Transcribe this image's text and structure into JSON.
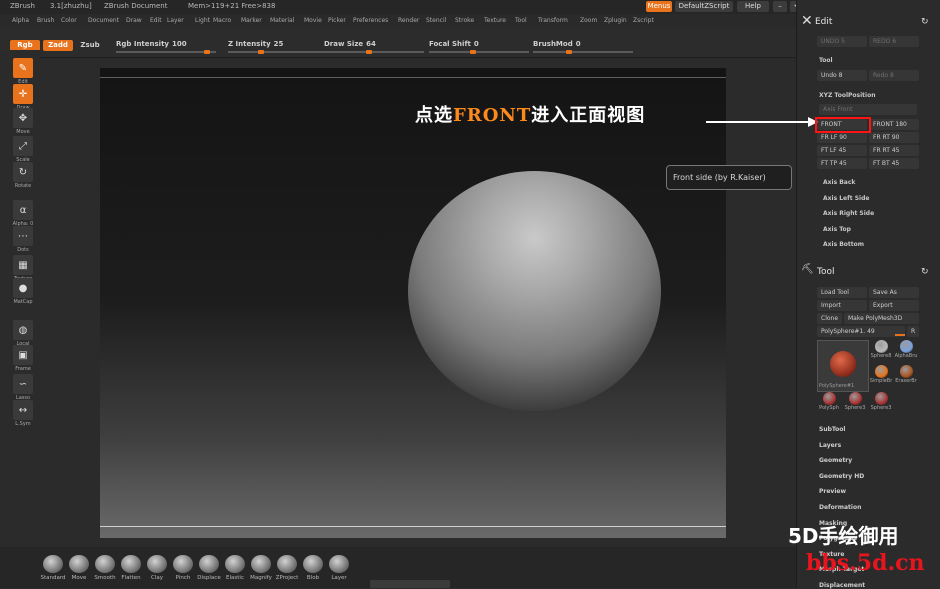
{
  "titlebar": {
    "app": "ZBrush",
    "version": "3.1[zhuzhu]",
    "doc": "ZBrush Document",
    "mem": "Mem>119+21  Free>838",
    "menus_btn": "Menus",
    "script_btn": "DefaultZScript",
    "help_btn": "Help"
  },
  "menubar": [
    "Alpha",
    "Brush",
    "Color",
    "Document",
    "Draw",
    "Edit",
    "Layer",
    "Light",
    "Macro",
    "Marker",
    "Material",
    "Movie",
    "Picker",
    "Preferences",
    "Render",
    "Stencil",
    "Stroke",
    "Texture",
    "Tool",
    "Transform",
    "Zoom",
    "Zplugin",
    "Zscript"
  ],
  "topbar": {
    "rgb": "Rgb",
    "zadd": "Zadd",
    "zsub": "Zsub",
    "sliders": [
      {
        "label": "Rgb Intensity",
        "value": "100"
      },
      {
        "label": "Z Intensity",
        "value": "25"
      },
      {
        "label": "Draw Size",
        "value": "64"
      },
      {
        "label": "Focal Shift",
        "value": "0"
      },
      {
        "label": "BrushMod",
        "value": "0"
      }
    ]
  },
  "lefttools": [
    {
      "label": "Edit",
      "icon": "edit-icon",
      "active": true
    },
    {
      "label": "Draw",
      "icon": "draw-icon",
      "active": true
    },
    {
      "label": "Move",
      "icon": "move-icon"
    },
    {
      "label": "Scale",
      "icon": "scale-icon"
    },
    {
      "label": "Rotate",
      "icon": "rotate-icon"
    },
    {
      "label": "Alpha: 0",
      "icon": "alpha-icon"
    },
    {
      "label": "Dots",
      "icon": "dots-icon"
    },
    {
      "label": "Texture",
      "icon": "texture-icon"
    },
    {
      "label": "MatCap",
      "icon": "matcap-icon"
    },
    {
      "label": "Local",
      "icon": "local-icon"
    },
    {
      "label": "Frame",
      "icon": "frame-icon"
    },
    {
      "label": "Lasso",
      "icon": "lasso-icon"
    },
    {
      "label": "L.Sym",
      "icon": "lsym-icon"
    }
  ],
  "brushes": [
    "Standard",
    "Move",
    "Smooth",
    "Flatten",
    "Clay",
    "Pinch",
    "Displace",
    "Elastic",
    "Magnify",
    "ZProject",
    "Blob",
    "Layer"
  ],
  "right": {
    "edit_title": "Edit",
    "undo": "UNDO 5",
    "redo": "REDO 6",
    "tool_sub": "Tool",
    "undo8": "Undo 8",
    "redo8": "Redo 8",
    "xyz": "XYZ ToolPosition",
    "axis_front": "Axis Front",
    "grid": [
      "FRONT",
      "FRONT 180",
      "FR LF 90",
      "FR RT 90",
      "FT LF 45",
      "FR RT 45",
      "FT TP 45",
      "FT BT 45"
    ],
    "axis_items": [
      "Axis Back",
      "Axis Left Side",
      "Axis Right Side",
      "Axis Top",
      "Axis Bottom"
    ],
    "tool_title": "Tool",
    "load": "Load Tool",
    "save": "Save As",
    "import": "Import",
    "export": "Export",
    "clone": "Clone",
    "make": "Make PolyMesh3D",
    "poly": "PolySphere#1. 49",
    "r": "R",
    "thumbs": [
      "PolySphere#1",
      "Sphere8",
      "AlphaBru",
      "SimpleBr",
      "EraserBr",
      "PolySph",
      "Sphere3",
      "Sphere3"
    ],
    "sections": [
      "SubTool",
      "Layers",
      "Geometry",
      "Geometry HD",
      "Preview",
      "Deformation",
      "Masking",
      "Polygroups",
      "Texture",
      "Morph Target",
      "Displacement"
    ]
  },
  "tooltip": "Front side (by R.Kaiser)",
  "annotation": {
    "pre": "点选",
    "front": "FRONT",
    "post": "进入正面视图"
  },
  "watermark": {
    "line1": "5D手绘御用",
    "line2": "bbs.5d.cn"
  },
  "colors": {
    "accent": "#e8731c",
    "highlight": "#ff1414"
  }
}
